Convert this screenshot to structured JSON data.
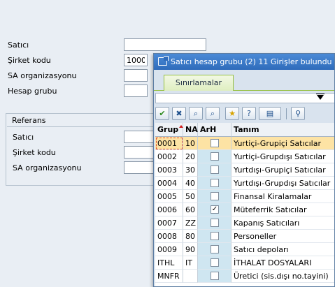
{
  "form": {
    "fields": [
      {
        "label": "Satıcı",
        "value": ""
      },
      {
        "label": "Şirket kodu",
        "value": "1000"
      },
      {
        "label": "SA organizasyonu",
        "value": ""
      },
      {
        "label": "Hesap grubu",
        "value": ""
      }
    ],
    "referans": {
      "title": "Referans",
      "fields": [
        {
          "label": "Satıcı",
          "value": ""
        },
        {
          "label": "Şirket kodu",
          "value": ""
        },
        {
          "label": "SA organizasyonu",
          "value": ""
        }
      ]
    }
  },
  "popup": {
    "title": "Satıcı hesap grubu (2)   11 Girişler bulundu",
    "tab_label": "Sınırlamalar",
    "toolbar": [
      {
        "icon": "checkmark-icon",
        "glyph": "✔"
      },
      {
        "icon": "cancel-icon",
        "glyph": "✖"
      },
      {
        "icon": "find-icon",
        "glyph": "⌕"
      },
      {
        "icon": "find-next-icon",
        "glyph": "⌕"
      },
      {
        "icon": "favorites-icon",
        "glyph": "★"
      },
      {
        "icon": "info-icon",
        "glyph": "?"
      },
      {
        "icon": "print-icon",
        "glyph": "▤"
      },
      {
        "icon": "pin-icon",
        "glyph": "⚲"
      }
    ],
    "columns": {
      "grup": "Grup",
      "na": "NA",
      "arh": "ArH",
      "tanim": "Tanım"
    },
    "rows": [
      {
        "grup": "0001",
        "na": "10",
        "arh": false,
        "tanim": "Yurtiçi-Grupiçi Satıcılar",
        "selected": true
      },
      {
        "grup": "0002",
        "na": "20",
        "arh": false,
        "tanim": "Yurtiçi-Grupdışı Satıcılar"
      },
      {
        "grup": "0003",
        "na": "30",
        "arh": false,
        "tanim": "Yurtdışı-Grupiçi Satıcılar"
      },
      {
        "grup": "0004",
        "na": "40",
        "arh": false,
        "tanim": "Yurtdışı-Grupdışı Satıcılar"
      },
      {
        "grup": "0005",
        "na": "50",
        "arh": false,
        "tanim": "Finansal Kiralamalar"
      },
      {
        "grup": "0006",
        "na": "60",
        "arh": true,
        "tanim": "Müteferrik Satıcılar"
      },
      {
        "grup": "0007",
        "na": "ZZ",
        "arh": false,
        "tanim": "Kapanış Satıcıları"
      },
      {
        "grup": "0008",
        "na": "80",
        "arh": false,
        "tanim": "Personeller"
      },
      {
        "grup": "0009",
        "na": "90",
        "arh": false,
        "tanim": "Satıcı depoları"
      },
      {
        "grup": "ITHL",
        "na": "IT",
        "arh": false,
        "tanim": "İTHALAT DOSYALARI"
      },
      {
        "grup": "MNFR",
        "na": "",
        "arh": false,
        "tanim": "Üretici (sis.dışı no.tayini)"
      }
    ]
  }
}
